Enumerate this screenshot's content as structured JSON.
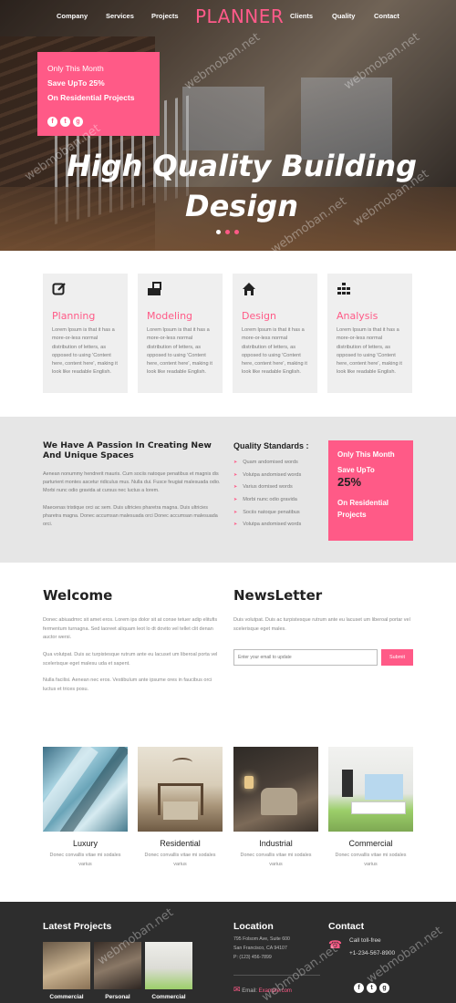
{
  "nav": {
    "left": [
      "Company",
      "Services",
      "Projects"
    ],
    "logo": "PLANNER",
    "right": [
      "Clients",
      "Quality",
      "Contact"
    ]
  },
  "hero": {
    "promo_line1": "Only This Month",
    "promo_line2": "Save UpTo 25%",
    "promo_line3": "On Residential Projects",
    "title_line1": "High Quality Building",
    "title_line2": "Design",
    "socials": [
      "f",
      "t",
      "g"
    ],
    "slides": 3,
    "active_slide": 1
  },
  "features": [
    {
      "icon": "edit-icon",
      "title": "Planning",
      "text": "Lorem Ipsum is that it has a more-or-less normal distribution of letters, as opposed to using 'Content here, content here', making it look like readable English."
    },
    {
      "icon": "blueprint-icon",
      "title": "Modeling",
      "text": "Lorem Ipsum is that it has a more-or-less normal distribution of letters, as opposed to using 'Content here, content here', making it look like readable English."
    },
    {
      "icon": "home-icon",
      "title": "Design",
      "text": "Lorem Ipsum is that it has a more-or-less normal distribution of letters, as opposed to using 'Content here, content here', making it look like readable English."
    },
    {
      "icon": "bars-icon",
      "title": "Analysis",
      "text": "Lorem Ipsum is that it has a more-or-less normal distribution of letters, as opposed to using 'Content here, content here', making it look like readable English."
    }
  ],
  "passion": {
    "title": "We Have A Passion In Creating New And Unique Spaces",
    "para1": "Aenean nonummy hendrerit mauris. Cum sociis natoque penatibus et magnis dis parturient montes ascetur ridiculus mus. Nulla dui. Fusce feugiat malesuada odio. Morbi nunc odio gravida at cursus nec luctus a lorem.",
    "para2": "Maecenas tristique orci ac sem. Duis ultricies pharetra magna. Duis ultricies pharetra magna. Donec accumsan malesuada orci Donec accumsan malesuada orci.",
    "quality_title": "Quality Standards :",
    "quality_items": [
      "Quam andomised words",
      "Volutpa andomised words",
      "Varius domised words",
      "Morbi nunc odio gravida",
      "Sociis natoque penatibus",
      "Volutpa andomised words"
    ],
    "offer_line1": "Only This Month",
    "offer_line2": "Save UpTo",
    "offer_line3": "25%",
    "offer_line4": "On Residential Projects"
  },
  "welcome": {
    "title": "Welcome",
    "para1": "Donec abiuadmrc sit amet eros. Lorem ips dolor sit at conse tetuer adip elitufis fermentum turnagna. Sed laoreet aliquam leot lo dt dovito vel tellet clit denan auctor wersi.",
    "para2": "Qua volutpat. Duis ac turpistesque rutrum ante eu lacuset um liberoal porta vel scelerisque eget malesu uda et sapent.",
    "para3": "Nulla facilisi. Aenean nec eros. Vestibulum ante ipsume ores in faucibus orci luctus et trices posu."
  },
  "newsletter": {
    "title": "NewsLetter",
    "text": "Duis volutpat. Duis ac turpistesque rutrum ante eu lacuset um liberoal portar vel scelerisque eget males.",
    "placeholder": "Enter your email to update",
    "submit": "Submit"
  },
  "gallery": [
    {
      "title": "Luxury",
      "text": "Donec convallis vitae mi sodales varius"
    },
    {
      "title": "Residential",
      "text": "Donec convallis vitae mi sodales varius"
    },
    {
      "title": "Industrial",
      "text": "Donec convallis vitae mi sodales varius"
    },
    {
      "title": "Commercial",
      "text": "Donec convallis vitae mi sodales varius"
    }
  ],
  "footer": {
    "projects_title": "Latest Projects",
    "projects": [
      "Commercial",
      "Personal",
      "Commercial"
    ],
    "location_title": "Location",
    "address1": "795 Folsom Ave, Suite 600",
    "address2": "San Francisco, CA 94107",
    "address3": "P: (123) 456-7899",
    "email_label": "Email:",
    "email": "Example.com",
    "contact_title": "Contact",
    "call_label": "Call toll-free",
    "phone": "+1-234-567-8900"
  },
  "watermark": "webmoban.net",
  "colors": {
    "accent": "#ff5a87",
    "footer": "#2d2d2d",
    "band": "#e6e6e6"
  }
}
